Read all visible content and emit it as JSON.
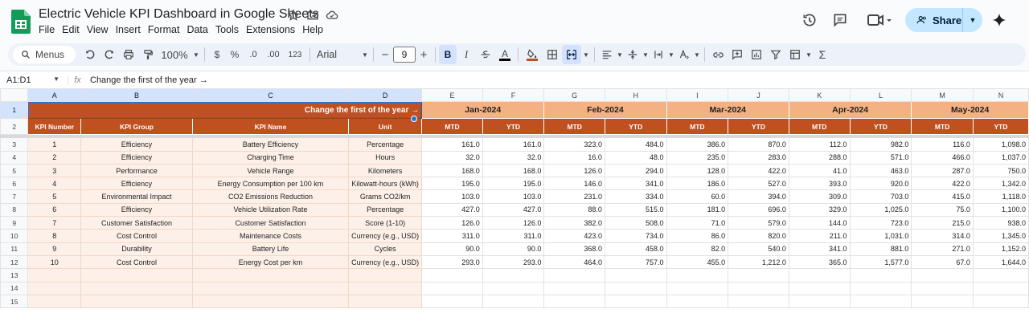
{
  "app": {
    "title": "Electric Vehicle KPI Dashboard in Google Sheets",
    "menus": [
      "File",
      "Edit",
      "View",
      "Insert",
      "Format",
      "Data",
      "Tools",
      "Extensions",
      "Help"
    ],
    "share_label": "Share"
  },
  "toolbar": {
    "menus_label": "Menus",
    "zoom": "100%",
    "currency": "$",
    "percent": "%",
    "dec_decrease": ".0",
    "dec_increase": ".00",
    "number_format": "123",
    "font": "Arial",
    "font_size": "9",
    "bold": "B",
    "text_color_glyph": "A"
  },
  "formula_bar": {
    "name_box": "A1:D1",
    "fx": "fx",
    "formula": "Change the first of the year →"
  },
  "grid": {
    "columns": [
      "A",
      "B",
      "C",
      "D",
      "E",
      "F",
      "G",
      "H",
      "I",
      "J",
      "K",
      "L",
      "M",
      "N"
    ],
    "row_numbers": [
      "1",
      "2",
      "3",
      "4",
      "5",
      "6",
      "7",
      "8",
      "9",
      "10",
      "11",
      "12",
      "13",
      "14",
      "15"
    ],
    "header_row1_text": "Change the first of the year →",
    "months": [
      "Jan-2024",
      "Feb-2024",
      "Mar-2024",
      "Apr-2024",
      "May-2024"
    ],
    "header_row2": [
      "KPI Number",
      "KPI Group",
      "KPI Name",
      "Unit",
      "MTD",
      "YTD",
      "MTD",
      "YTD",
      "MTD",
      "YTD",
      "MTD",
      "YTD",
      "MTD",
      "YTD"
    ],
    "rows": [
      [
        "1",
        "Efficiency",
        "Battery Efficiency",
        "Percentage",
        "161.0",
        "161.0",
        "323.0",
        "484.0",
        "386.0",
        "870.0",
        "112.0",
        "982.0",
        "116.0",
        "1,098.0"
      ],
      [
        "2",
        "Efficiency",
        "Charging Time",
        "Hours",
        "32.0",
        "32.0",
        "16.0",
        "48.0",
        "235.0",
        "283.0",
        "288.0",
        "571.0",
        "466.0",
        "1,037.0"
      ],
      [
        "3",
        "Performance",
        "Vehicle Range",
        "Kilometers",
        "168.0",
        "168.0",
        "126.0",
        "294.0",
        "128.0",
        "422.0",
        "41.0",
        "463.0",
        "287.0",
        "750.0"
      ],
      [
        "4",
        "Efficiency",
        "Energy Consumption per 100 km",
        "Kilowatt-hours (kWh)",
        "195.0",
        "195.0",
        "146.0",
        "341.0",
        "186.0",
        "527.0",
        "393.0",
        "920.0",
        "422.0",
        "1,342.0"
      ],
      [
        "5",
        "Environmental Impact",
        "CO2 Emissions Reduction",
        "Grams CO2/km",
        "103.0",
        "103.0",
        "231.0",
        "334.0",
        "60.0",
        "394.0",
        "309.0",
        "703.0",
        "415.0",
        "1,118.0"
      ],
      [
        "6",
        "Efficiency",
        "Vehicle Utilization Rate",
        "Percentage",
        "427.0",
        "427.0",
        "88.0",
        "515.0",
        "181.0",
        "696.0",
        "329.0",
        "1,025.0",
        "75.0",
        "1,100.0"
      ],
      [
        "7",
        "Customer Satisfaction",
        "Customer Satisfaction",
        "Score (1-10)",
        "126.0",
        "126.0",
        "382.0",
        "508.0",
        "71.0",
        "579.0",
        "144.0",
        "723.0",
        "215.0",
        "938.0"
      ],
      [
        "8",
        "Cost Control",
        "Maintenance Costs",
        "Currency (e.g., USD)",
        "311.0",
        "311.0",
        "423.0",
        "734.0",
        "86.0",
        "820.0",
        "211.0",
        "1,031.0",
        "314.0",
        "1,345.0"
      ],
      [
        "9",
        "Durability",
        "Battery Life",
        "Cycles",
        "90.0",
        "90.0",
        "368.0",
        "458.0",
        "82.0",
        "540.0",
        "341.0",
        "881.0",
        "271.0",
        "1,152.0"
      ],
      [
        "10",
        "Cost Control",
        "Energy Cost per km",
        "Currency (e.g., USD)",
        "293.0",
        "293.0",
        "464.0",
        "757.0",
        "455.0",
        "1,212.0",
        "365.0",
        "1,577.0",
        "67.0",
        "1,644.0"
      ]
    ]
  },
  "colors": {
    "header_dark": "#c0501f",
    "header_month": "#f4b183",
    "label_fill": "#fdf0e8",
    "share_bg": "#c2e7ff",
    "logo_green": "#0f9d58"
  },
  "icons": [
    "sheets-logo-icon",
    "star-icon",
    "move-folder-icon",
    "cloud-status-icon",
    "history-icon",
    "comment-icon",
    "meet-icon",
    "people-icon",
    "gemini-icon",
    "search-icon",
    "undo-icon",
    "redo-icon",
    "print-icon",
    "paint-format-icon",
    "strikethrough-icon",
    "fill-color-icon",
    "borders-icon",
    "merge-cells-icon",
    "align-left-icon",
    "valign-icon",
    "text-rotation-icon",
    "link-icon",
    "comment-add-icon",
    "chart-icon",
    "filter-icon",
    "filter-views-icon",
    "functions-icon"
  ]
}
